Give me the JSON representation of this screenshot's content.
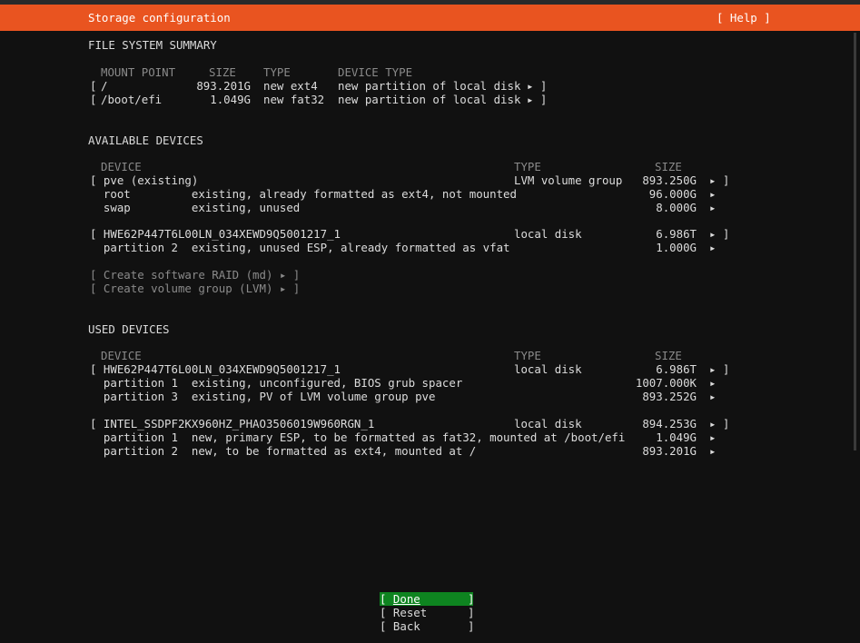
{
  "header": {
    "title": "Storage configuration",
    "help": "[ Help ]"
  },
  "fs_summary": {
    "heading": "FILE SYSTEM SUMMARY",
    "col_mount": "MOUNT POINT",
    "col_size": "SIZE",
    "col_type": "TYPE",
    "col_devtype": "DEVICE TYPE",
    "rows": [
      {
        "open": "[",
        "mount": "/",
        "size": "893.201G",
        "type": "new ext4",
        "devtype": "new partition of local disk",
        "arrow": "▸ ]"
      },
      {
        "open": "[",
        "mount": "/boot/efi",
        "size": "1.049G",
        "type": "new fat32",
        "devtype": "new partition of local disk",
        "arrow": "▸ ]"
      }
    ]
  },
  "available": {
    "heading": "AVAILABLE DEVICES",
    "col_device": "DEVICE",
    "col_type": "TYPE",
    "col_size": "SIZE",
    "rows": [
      {
        "text": "[ pve (existing)",
        "type": "LVM volume group",
        "size": "893.250G",
        "arrow": "▸ ]"
      },
      {
        "text": "  root         existing, already formatted as ext4, not mounted",
        "type": "",
        "size": "96.000G",
        "arrow": "▸"
      },
      {
        "text": "  swap         existing, unused",
        "type": "",
        "size": "8.000G",
        "arrow": "▸"
      },
      {
        "text": "[ HWE62P447T6L00LN_034XEWD9Q5001217_1",
        "type": "local disk",
        "size": "6.986T",
        "arrow": "▸ ]"
      },
      {
        "text": "  partition 2  existing, unused ESP, already formatted as vfat",
        "type": "",
        "size": "1.000G",
        "arrow": "▸"
      }
    ],
    "create_raid": "[ Create software RAID (md) ▸ ]",
    "create_vg": "[ Create volume group (LVM) ▸ ]"
  },
  "used": {
    "heading": "USED DEVICES",
    "col_device": "DEVICE",
    "col_type": "TYPE",
    "col_size": "SIZE",
    "rows": [
      {
        "text": "[ HWE62P447T6L00LN_034XEWD9Q5001217_1",
        "type": "local disk",
        "size": "6.986T",
        "arrow": "▸ ]"
      },
      {
        "text": "  partition 1  existing, unconfigured, BIOS grub spacer",
        "type": "",
        "size": "1007.000K",
        "arrow": "▸"
      },
      {
        "text": "  partition 3  existing, PV of LVM volume group pve",
        "type": "",
        "size": "893.252G",
        "arrow": "▸"
      },
      {
        "text": "[ INTEL_SSDPF2KX960HZ_PHAO3506019W960RGN_1",
        "type": "local disk",
        "size": "894.253G",
        "arrow": "▸ ]"
      },
      {
        "text": "  partition 1  new, primary ESP, to be formatted as fat32, mounted at /boot/efi",
        "type": "",
        "size": "1.049G",
        "arrow": "▸"
      },
      {
        "text": "  partition 2  new, to be formatted as ext4, mounted at /",
        "type": "",
        "size": "893.201G",
        "arrow": "▸"
      }
    ]
  },
  "buttons": {
    "done_open": "[ ",
    "done": "Done",
    "done_close": "       ]",
    "reset": "[ Reset      ]",
    "back": "[ Back       ]"
  }
}
